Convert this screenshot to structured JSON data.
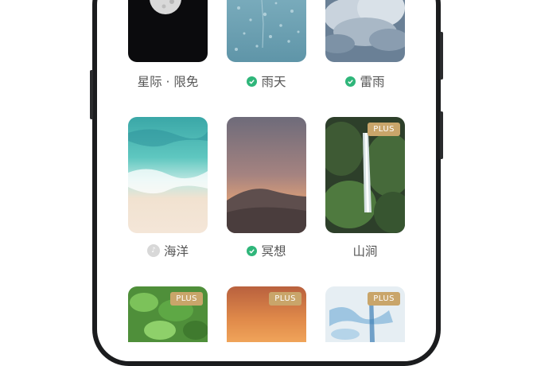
{
  "colors": {
    "accent_check": "#2fb67a",
    "plus_badge": "#c9a56a",
    "label_text": "#555555"
  },
  "scenes": [
    {
      "label": "星际 · 限免",
      "icon": "none",
      "plus": "",
      "image": "moon-night"
    },
    {
      "label": "雨天",
      "icon": "check-icon",
      "plus": "",
      "image": "raindrops-glass"
    },
    {
      "label": "雷雨",
      "icon": "check-icon",
      "plus": "",
      "image": "storm-clouds"
    },
    {
      "label": "海洋",
      "icon": "music-icon",
      "plus": "",
      "image": "ocean-beach"
    },
    {
      "label": "冥想",
      "icon": "check-icon",
      "plus": "",
      "image": "desert-dusk"
    },
    {
      "label": "山涧",
      "icon": "none",
      "plus": "PLUS",
      "image": "waterfall-forest"
    },
    {
      "label": "",
      "icon": "none",
      "plus": "PLUS",
      "image": "green-leaves"
    },
    {
      "label": "",
      "icon": "none",
      "plus": "PLUS",
      "image": "orange-sunset"
    },
    {
      "label": "",
      "icon": "none",
      "plus": "PLUS",
      "image": "blue-watercolor"
    }
  ]
}
